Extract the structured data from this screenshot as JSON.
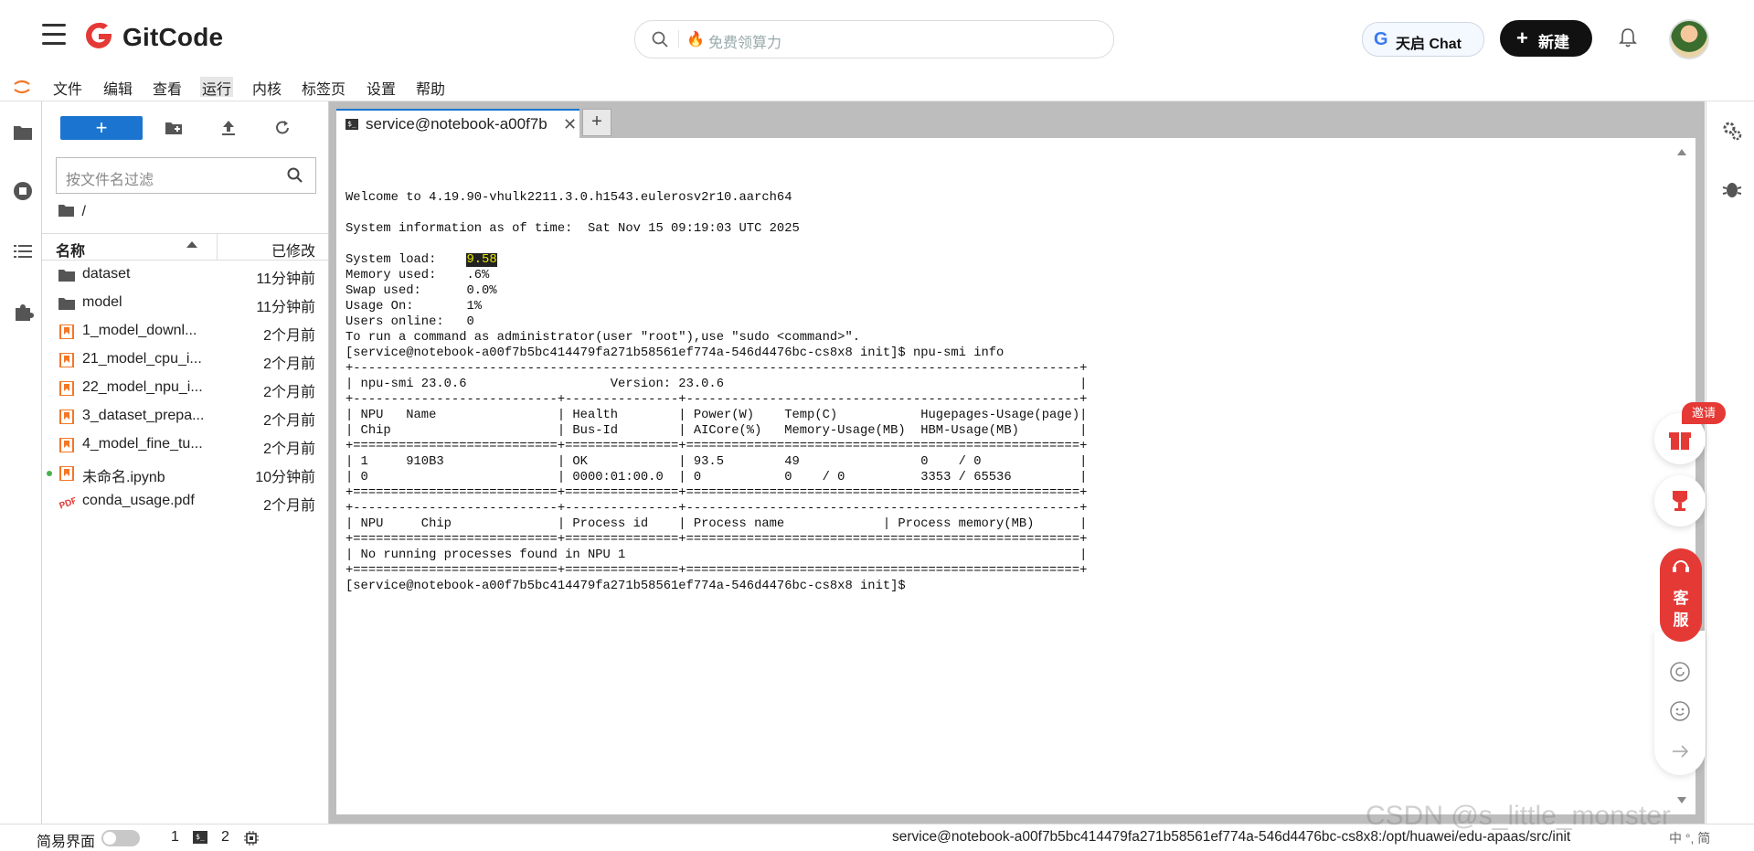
{
  "header": {
    "logo_text": "GitCode",
    "search_placeholder": "免费领算力",
    "chat_label": "天启 Chat",
    "new_label": "新建"
  },
  "menu": [
    "文件",
    "编辑",
    "查看",
    "运行",
    "内核",
    "标签页",
    "设置",
    "帮助"
  ],
  "menu_active": "运行",
  "file_browser": {
    "filter_placeholder": "按文件名过滤",
    "breadcrumb": "/",
    "col_name": "名称",
    "col_modified": "已修改",
    "files": [
      {
        "name": "dataset",
        "modified": "11分钟前",
        "kind": "folder"
      },
      {
        "name": "model",
        "modified": "11分钟前",
        "kind": "folder"
      },
      {
        "name": "1_model_downl...",
        "modified": "2个月前",
        "kind": "notebook"
      },
      {
        "name": "21_model_cpu_i...",
        "modified": "2个月前",
        "kind": "notebook"
      },
      {
        "name": "22_model_npu_i...",
        "modified": "2个月前",
        "kind": "notebook"
      },
      {
        "name": "3_dataset_prepa...",
        "modified": "2个月前",
        "kind": "notebook"
      },
      {
        "name": "4_model_fine_tu...",
        "modified": "2个月前",
        "kind": "notebook"
      },
      {
        "name": "未命名.ipynb",
        "modified": "10分钟前",
        "kind": "notebook",
        "running": true
      },
      {
        "name": "conda_usage.pdf",
        "modified": "2个月前",
        "kind": "pdf"
      }
    ]
  },
  "tab": {
    "title": "service@notebook-a00f7b",
    "icon_text": "$_",
    "add_label": "+"
  },
  "terminal": {
    "lines": [
      "",
      "Welcome to 4.19.90-vhulk2211.3.0.h1543.eulerosv2r10.aarch64",
      "",
      "System information as of time:  Sat Nov 15 09:19:03 UTC 2025",
      "",
      "System load:    ",
      "Memory used:    .6%",
      "Swap used:      0.0%",
      "Usage On:       1%",
      "Users online:   0",
      "To run a command as administrator(user \"root\"),use \"sudo <command>\".",
      "[service@notebook-a00f7b5bc414479fa271b58561ef774a-546d4476bc-cs8x8 init]$ npu-smi info",
      "+------------------------------------------------------------------------------------------------+",
      "| npu-smi 23.0.6                   Version: 23.0.6                                               |",
      "+---------------------------+---------------+----------------------------------------------------+",
      "| NPU   Name                | Health        | Power(W)    Temp(C)           Hugepages-Usage(page)|",
      "| Chip                      | Bus-Id        | AICore(%)   Memory-Usage(MB)  HBM-Usage(MB)        |",
      "+===========================+===============+====================================================+",
      "| 1     910B3               | OK            | 93.5        49                0    / 0             |",
      "| 0                         | 0000:01:00.0  | 0           0    / 0          3353 / 65536         |",
      "+===========================+===============+====================================================+",
      "+---------------------------+---------------+----------------------------------------------------+",
      "| NPU     Chip              | Process id    | Process name             | Process memory(MB)      |",
      "+===========================+===============+====================================================+",
      "| No running processes found in NPU 1                                                            |",
      "+===========================+===============+====================================================+",
      "[service@notebook-a00f7b5bc414479fa271b58561ef774a-546d4476bc-cs8x8 init]$"
    ],
    "system_load_value": "9.58"
  },
  "float_widget": {
    "badge": "邀请",
    "service_label_1": "客",
    "service_label_2": "服"
  },
  "status_bar": {
    "simple_mode": "简易界面",
    "count_a": "1",
    "count_b": "2",
    "path": "service@notebook-a00f7b5bc414479fa271b58561ef774a-546d4476bc-cs8x8:/opt/huawei/edu-apaas/src/init",
    "ime": "中 °, 简"
  },
  "watermark": "CSDN @s_little_monster",
  "colors": {
    "brand_red": "#e53935",
    "accent_blue": "#1b75d0",
    "highlight_yellow": "#e6e600"
  }
}
